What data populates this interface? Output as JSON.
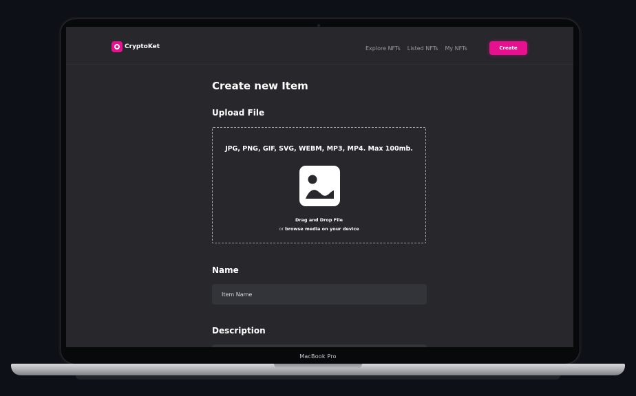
{
  "device": {
    "label": "MacBook Pro"
  },
  "navbar": {
    "brand": "CryptoKet",
    "links": [
      "Explore NFTs",
      "Listed NFTs",
      "My NFTs"
    ],
    "create_label": "Create"
  },
  "form": {
    "title": "Create new Item",
    "upload": {
      "heading": "Upload File",
      "formats": "JPG, PNG, GIF, SVG, WEBM, MP3, MP4. Max 100mb.",
      "drag_text": "Drag and Drop File",
      "browse_prefix": "or",
      "browse_link": "browse media on your device"
    },
    "name": {
      "heading": "Name",
      "placeholder": "Item Name",
      "value": ""
    },
    "description": {
      "heading": "Description"
    }
  },
  "colors": {
    "accent": "#e5118f",
    "background": "#27272c",
    "input": "#33333a"
  }
}
